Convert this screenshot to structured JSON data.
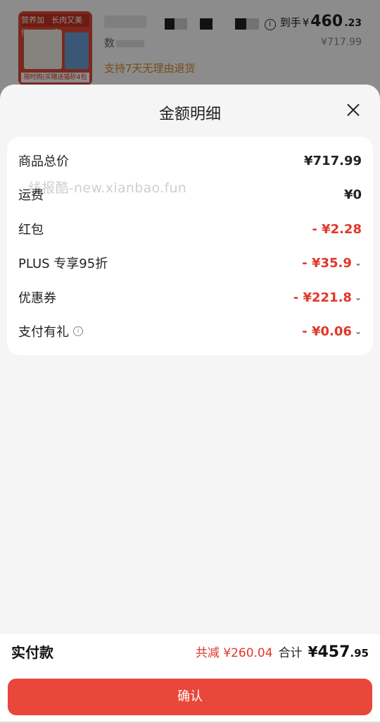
{
  "background_product": {
    "thumb_top_left": "营养加倍",
    "thumb_top_right": "长肉又美毛",
    "thumb_bottom": "限时购|买赠送猫砂4包",
    "qty_label": "数",
    "arrive_label": "到手",
    "arrive_currency": "¥",
    "arrive_int": "460",
    "arrive_dec": ".23",
    "original_price": "¥717.99",
    "return_note": "支持7天无理由退货"
  },
  "sheet": {
    "title": "金额明细",
    "watermark": "线报酷-new.xianbao.fun",
    "rows": [
      {
        "label": "商品总价",
        "value": "¥717.99"
      },
      {
        "label": "运费",
        "value": "¥0"
      },
      {
        "label": "红包",
        "value": "- ¥2.28"
      },
      {
        "label": "PLUS 专享95折",
        "value": "- ¥35.9"
      },
      {
        "label": "优惠券",
        "value": "- ¥221.8"
      },
      {
        "label": "支付有礼",
        "value": "- ¥0.06"
      }
    ]
  },
  "footer": {
    "pay_label": "实付款",
    "reduce_text": "共减 ¥260.04",
    "sum_label": "合计",
    "sum_currency": "¥",
    "sum_int": "457",
    "sum_dec": ".95",
    "confirm_label": "确认"
  },
  "colors": {
    "accent_red": "#e2362a",
    "button_red": "#e8473a",
    "note_orange": "#d88a2a"
  }
}
